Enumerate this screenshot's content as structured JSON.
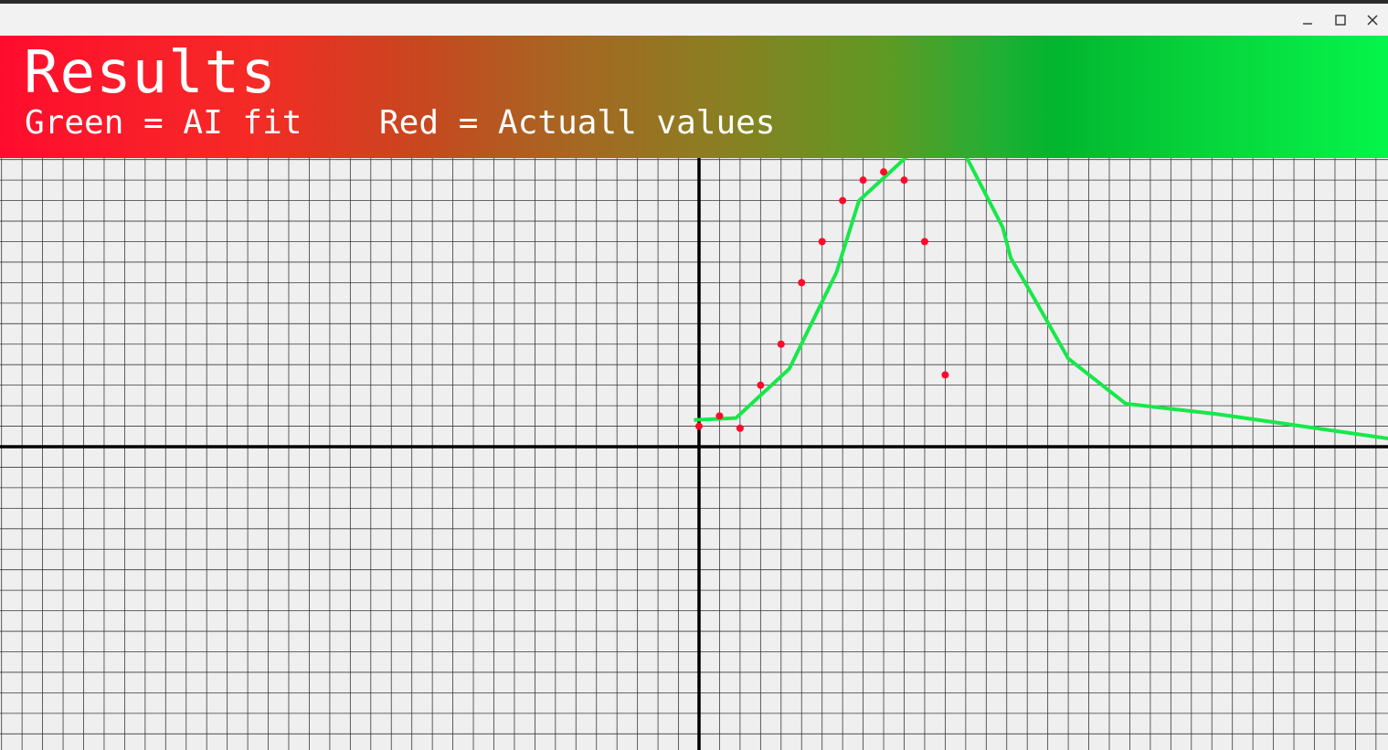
{
  "window": {
    "controls": [
      "minimize",
      "maximize",
      "close"
    ]
  },
  "header": {
    "title": "Results",
    "legend_green": "Green = AI fit",
    "legend_red": "Red = Actuall values"
  },
  "colors": {
    "fit_line": "#17e84a",
    "actual_points": "#ff0a2a",
    "grid": "#3a3a3a",
    "axes": "#000000",
    "background": "#efefef"
  },
  "chart_data": {
    "type": "scatter",
    "title": "",
    "xlabel": "",
    "ylabel": "",
    "grid": true,
    "series": [
      {
        "kind": "line",
        "x": [
          -0.25,
          1.8,
          4.4,
          6.7,
          7.8,
          10.3,
          12.2,
          13.1,
          14.8,
          15.2,
          16.3,
          18.0,
          20.8,
          25.2,
          35.0,
          41.5,
          50.0
        ],
        "y": [
          1.3,
          1.4,
          3.8,
          8.5,
          12.0,
          14.3,
          15.4,
          14.0,
          10.7,
          9.2,
          7.3,
          4.3,
          2.1,
          1.6,
          0.2,
          0.2,
          0.2
        ]
      },
      {
        "kind": "points",
        "x": [
          0.0,
          1.0,
          2.0,
          3.0,
          4.0,
          5.0,
          6.0,
          7.0,
          8.0,
          9.0,
          10.0,
          11.0,
          12.0
        ],
        "y": [
          1.0,
          1.5,
          0.9,
          3.0,
          5.0,
          8.0,
          10.0,
          12.0,
          13.0,
          13.4,
          13.0,
          10.0,
          3.5
        ]
      }
    ]
  }
}
